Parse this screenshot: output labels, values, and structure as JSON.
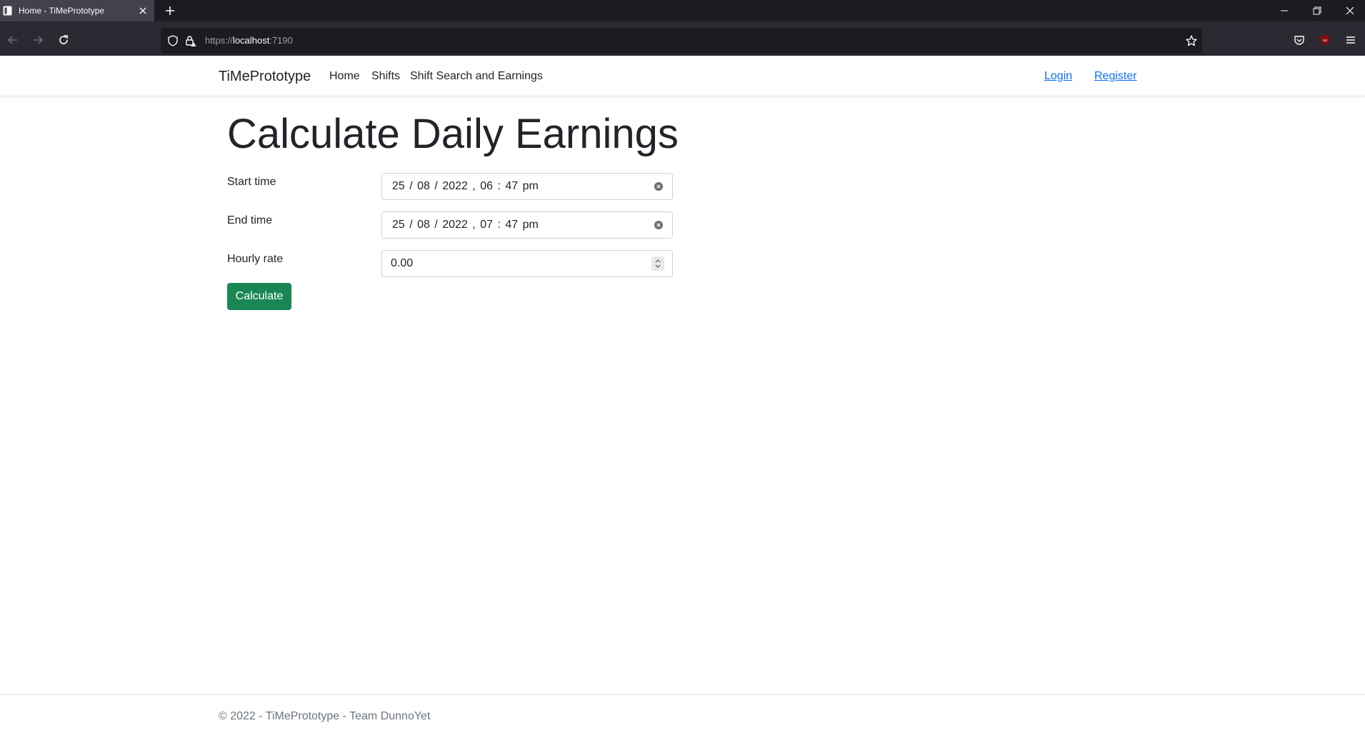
{
  "browser": {
    "tab_title": "Home - TiMePrototype",
    "url_scheme": "https://",
    "url_host": "localhost",
    "url_port": ":7190"
  },
  "navbar": {
    "brand": "TiMePrototype",
    "links": [
      "Home",
      "Shifts",
      "Shift Search and Earnings"
    ],
    "auth_links": [
      "Login",
      "Register"
    ]
  },
  "main": {
    "title": "Calculate Daily Earnings",
    "fields": {
      "start_time": {
        "label": "Start time",
        "value": "25 / 08 / 2022 ,  06 : 47   pm"
      },
      "end_time": {
        "label": "End time",
        "value": "25 / 08 / 2022 ,  07 : 47   pm"
      },
      "hourly_rate": {
        "label": "Hourly rate",
        "value": "0.00"
      }
    },
    "submit_label": "Calculate"
  },
  "footer": {
    "text": "© 2022 - TiMePrototype - Team DunnoYet"
  },
  "colors": {
    "primary_button": "#198754",
    "link": "#0d6efd",
    "browser_chrome": "#2b2a33"
  }
}
